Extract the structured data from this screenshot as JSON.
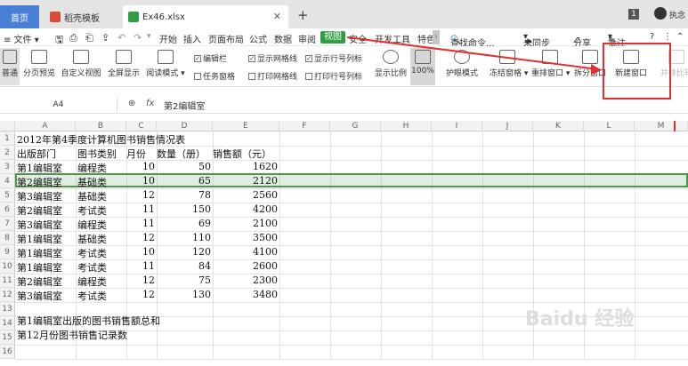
{
  "tabs": {
    "home": "首页",
    "doc": "稻壳模板",
    "file": "Ex46.xlsx"
  },
  "titlebar": {
    "badge": "1",
    "user": "执念"
  },
  "menu": {
    "file": "≡ 文件 ▾",
    "items": [
      "开始",
      "插入",
      "页面布局",
      "公式",
      "数据",
      "审阅",
      "视图",
      "安全",
      "开发工具",
      "特色"
    ],
    "search": "查找命令...",
    "sync": "未同步",
    "share": "分享",
    "annotate": "批注",
    "help": "?"
  },
  "ribbon": {
    "normal": "普通",
    "page_preview": "分页预览",
    "custom_view": "自定义视图",
    "fullscreen": "全屏显示",
    "reading_mode": "阅读模式",
    "edit_bar": "编辑栏",
    "task_pane": "任务窗格",
    "gridlines": "显示网格线",
    "print_gridlines": "打印网格线",
    "row_col_headers": "显示行号列标",
    "print_row_col": "打印行号列标",
    "zoom": "显示比例",
    "zoom_100": "100%",
    "eye_mode": "护眼模式",
    "freeze": "冻结窗格",
    "rearrange": "重排窗口",
    "split": "拆分窗口",
    "new_window": "新建窗口",
    "side_by_side": "并排比较"
  },
  "formula_bar": {
    "cell_ref": "A4",
    "fx": "fx",
    "content": "第2编辑室"
  },
  "columns": [
    "A",
    "B",
    "C",
    "D",
    "E",
    "F",
    "G",
    "H",
    "I",
    "J",
    "K",
    "L",
    "M"
  ],
  "rows": [
    "1",
    "2",
    "3",
    "4",
    "5",
    "6",
    "7",
    "8",
    "9",
    "10",
    "11",
    "12",
    "13",
    "14",
    "15",
    "16"
  ],
  "sheet": {
    "title": "2012年第4季度计算机图书销售情况表",
    "headers": [
      "出版部门",
      "图书类别",
      "月份",
      "数量（册）",
      "销售额（元）"
    ],
    "data": [
      [
        "第1编辑室",
        "编程类",
        "10",
        "50",
        "1620"
      ],
      [
        "第2编辑室",
        "基础类",
        "10",
        "65",
        "2120"
      ],
      [
        "第3编辑室",
        "基础类",
        "12",
        "78",
        "2560"
      ],
      [
        "第2编辑室",
        "考试类",
        "11",
        "150",
        "4200"
      ],
      [
        "第3编辑室",
        "编程类",
        "11",
        "69",
        "2100"
      ],
      [
        "第1编辑室",
        "基础类",
        "12",
        "110",
        "3500"
      ],
      [
        "第1编辑室",
        "考试类",
        "10",
        "120",
        "4100"
      ],
      [
        "第1编辑室",
        "考试类",
        "11",
        "84",
        "2600"
      ],
      [
        "第2编辑室",
        "编程类",
        "12",
        "75",
        "2300"
      ],
      [
        "第3编辑室",
        "考试类",
        "12",
        "130",
        "3480"
      ]
    ],
    "note1": "第1编辑室出版的图书销售额总和",
    "note2": "第12月份图书销售记录数"
  },
  "watermark": "Baidu 经验",
  "colors": {
    "accent": "#2f9e44",
    "home_tab": "#4a7fd6",
    "annotation": "#e03030"
  }
}
